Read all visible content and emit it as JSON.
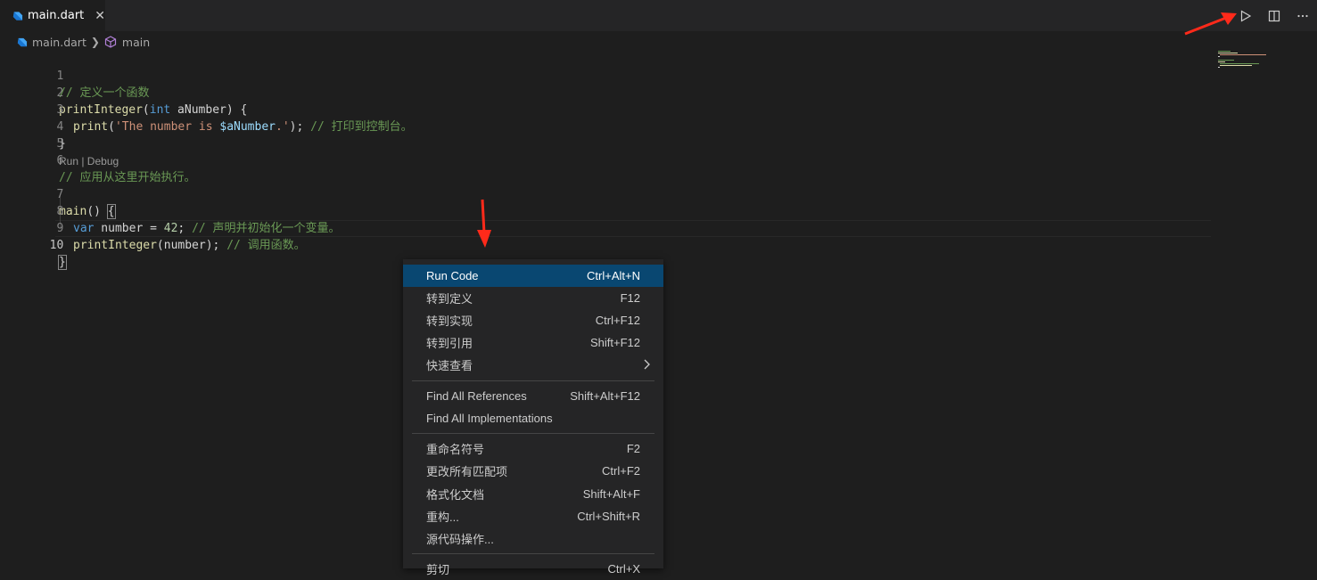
{
  "tab": {
    "filename": "main.dart",
    "close": "✕"
  },
  "breadcrumb": {
    "file": "main.dart",
    "symbol": "main"
  },
  "editor": {
    "line_numbers": [
      "1",
      "2",
      "3",
      "4",
      "5",
      "6",
      "7",
      "8",
      "9",
      "10"
    ],
    "codelens": "Run | Debug",
    "lines": [
      {
        "c1": "// 定义一个函数"
      },
      {
        "fn": "printInteger",
        "p1": "(",
        "kw": "int",
        "p2": " aNumber) {"
      },
      {
        "fn": "print",
        "p1": "(",
        "str1": "'The number is ",
        "var": "$aNumber",
        "str2": ".'",
        "p2": "); ",
        "cm": "// 打印到控制台。"
      },
      {
        "p1": "}"
      },
      {},
      {
        "c1": "// 应用从这里开始执行。"
      },
      {
        "fn": "main",
        "p1": "() ",
        "brace": "{"
      },
      {
        "kw": "var",
        "p1": " number = ",
        "num": "42",
        "p2": "; ",
        "cm": "// 声明并初始化一个变量。"
      },
      {
        "fn": "printInteger",
        "p1": "(number); ",
        "cm": "// 调用函数。"
      },
      {
        "brace": "}"
      }
    ]
  },
  "context_menu": {
    "group1": [
      {
        "label": "Run Code",
        "key": "Ctrl+Alt+N"
      },
      {
        "label": "转到定义",
        "key": "F12"
      },
      {
        "label": "转到实现",
        "key": "Ctrl+F12"
      },
      {
        "label": "转到引用",
        "key": "Shift+F12"
      },
      {
        "label": "快速查看",
        "key": ""
      }
    ],
    "group2": [
      {
        "label": "Find All References",
        "key": "Shift+Alt+F12"
      },
      {
        "label": "Find All Implementations",
        "key": ""
      }
    ],
    "group3": [
      {
        "label": "重命名符号",
        "key": "F2"
      },
      {
        "label": "更改所有匹配项",
        "key": "Ctrl+F2"
      },
      {
        "label": "格式化文档",
        "key": "Shift+Alt+F"
      },
      {
        "label": "重构...",
        "key": "Ctrl+Shift+R"
      },
      {
        "label": "源代码操作...",
        "key": ""
      }
    ],
    "group4": [
      {
        "label": "剪切",
        "key": "Ctrl+X"
      }
    ]
  },
  "colors": {
    "selected": "#094771",
    "comment": "#6a9955",
    "function": "#dcdcaa",
    "keyword": "#569cd6",
    "string": "#ce9178",
    "number": "#b5cea8",
    "annotation_arrow": "#ff2a1a"
  },
  "icons": [
    "dart-icon",
    "close-icon",
    "symbol-cube-icon",
    "run-icon",
    "split-editor-icon",
    "more-actions-icon",
    "chevron-right-icon"
  ]
}
